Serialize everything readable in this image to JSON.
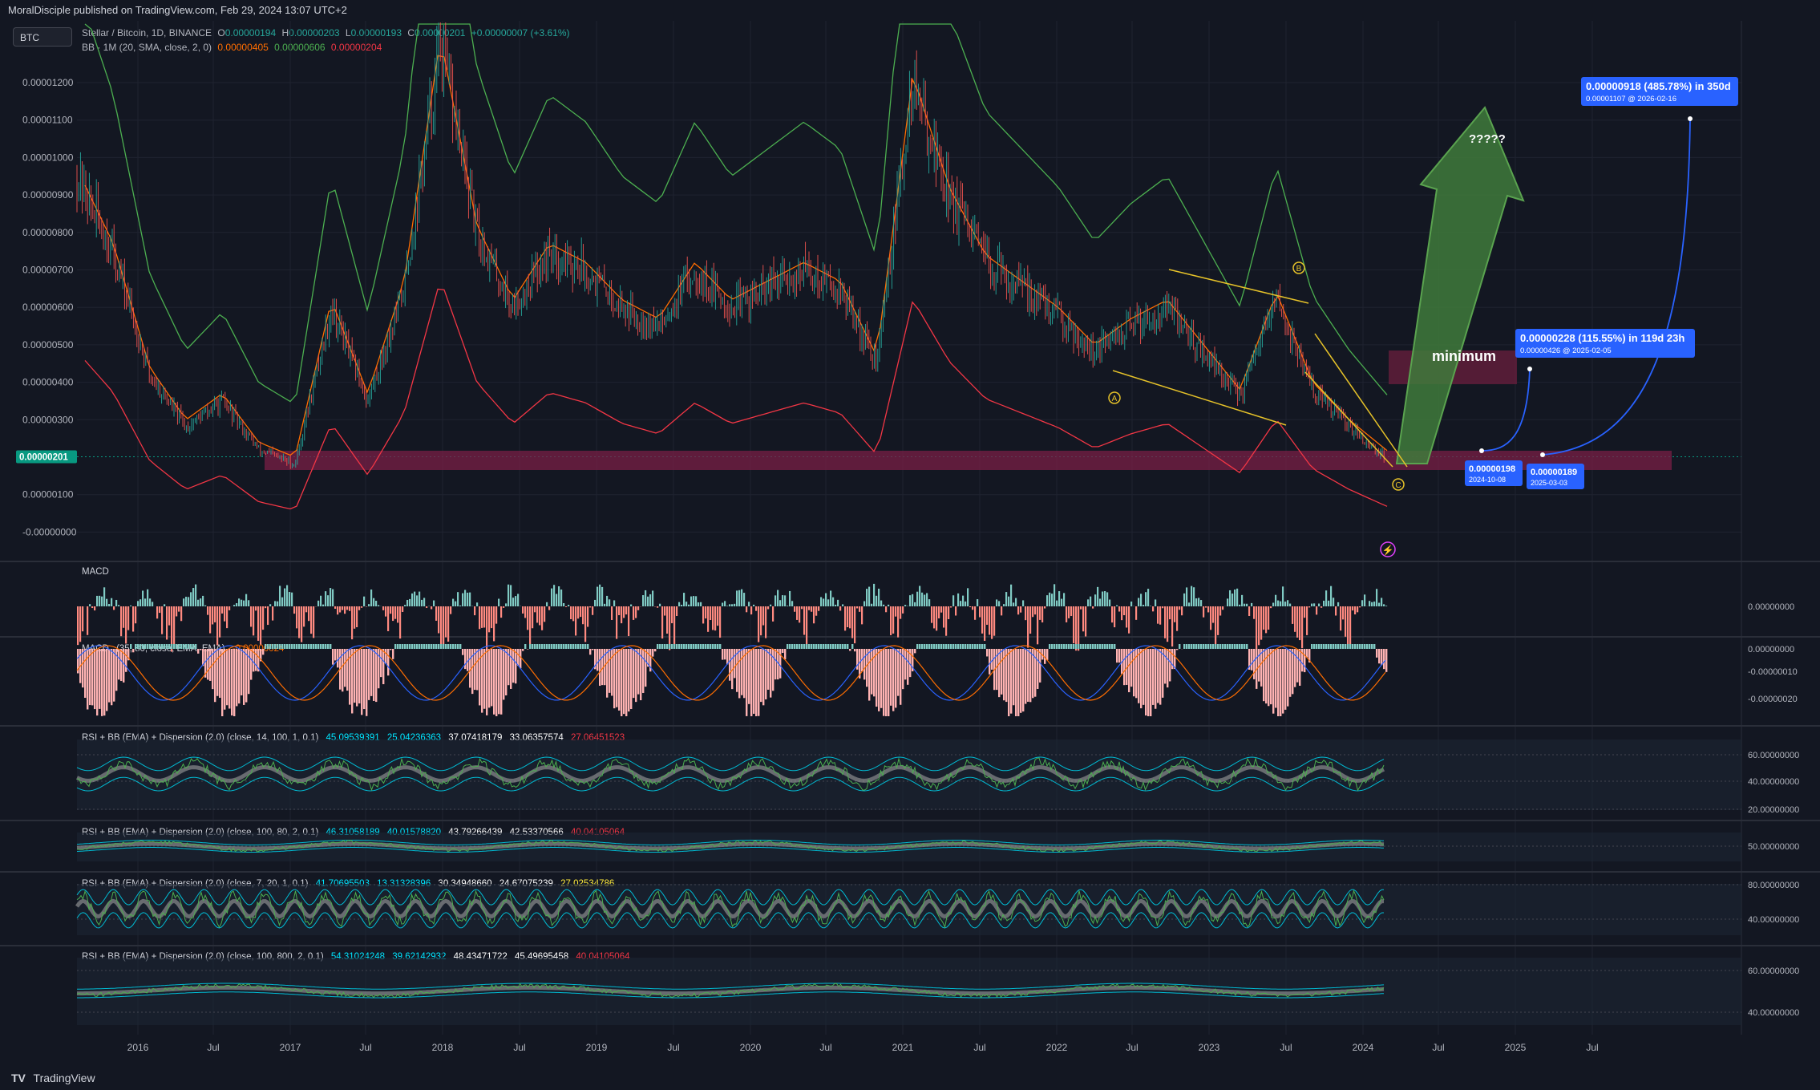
{
  "header": {
    "published": "MoralDisciple published on TradingView.com, Feb 29, 2024 13:07 UTC+2"
  },
  "footer": {
    "brand": "TradingView"
  },
  "symbol_badge": "BTC",
  "legend_main": {
    "title": "Stellar / Bitcoin, 1D, BINANCE",
    "o_label": "O",
    "o": "0.00000194",
    "h_label": "H",
    "h": "0.00000203",
    "l_label": "L",
    "l": "0.00000193",
    "c_label": "C",
    "c": "0.00000201",
    "change": "+0.00000007 (+3.61%)"
  },
  "legend_bb": {
    "label": "BB · 1M (20, SMA, close, 2, 0)",
    "v1": "0.00000405",
    "v2": "0.00000606",
    "v3": "0.00000204"
  },
  "price_axis": {
    "labels": [
      "0.00001200",
      "0.00001100",
      "0.00001000",
      "0.00000900",
      "0.00000800",
      "0.00000700",
      "0.00000600",
      "0.00000500",
      "0.00000400",
      "0.00000300",
      "0.00000100",
      "-0.00000000"
    ],
    "current": "0.00000201"
  },
  "annotations": {
    "wave_a": "A",
    "wave_b": "B",
    "wave_c": "C",
    "minimum": "minimum",
    "question": "?????",
    "proj1_title": "0.00000228 (115.55%) in 119d 23h",
    "proj1_sub": "0.00000426 @ 2025-02-05",
    "proj2_title": "0.00000918 (485.78%) in 350d",
    "proj2_sub": "0.00001107 @ 2026-02-16",
    "point1_val": "0.00000198",
    "point1_date": "2024-10-08",
    "point2_val": "0.00000189",
    "point2_date": "2025-03-03"
  },
  "panels": {
    "macd1": {
      "label": "MACD",
      "axis": [
        "0.00000000"
      ]
    },
    "macd2": {
      "label": "MACD",
      "params": "(35, 80, close, EMA, EMA)",
      "v": "-0.00000024",
      "axis": [
        "0.00000000",
        "-0.00000010",
        "-0.00000020"
      ]
    },
    "rsi1": {
      "label": "RSI + BB (EMA) + Dispersion (2.0) (close, 14, 100, 1, 0.1)",
      "values": [
        "45.09539391",
        "25.04236363",
        "37.07418179",
        "33.06357574",
        "27.06451523"
      ],
      "axis": [
        "60.00000000",
        "40.00000000",
        "20.00000000"
      ]
    },
    "rsi2": {
      "label": "RSI + BB (EMA) + Dispersion (2.0) (close, 100, 80, 2, 0.1)",
      "values": [
        "46.31058189",
        "40.01578820",
        "43.79266439",
        "42.53370566",
        "40.04105064"
      ],
      "axis": [
        "50.00000000"
      ]
    },
    "rsi3": {
      "label": "RSI + BB (EMA) + Dispersion (2.0) (close, 7, 20, 1, 0.1)",
      "values": [
        "41.70695503",
        "13.31328396",
        "30.34948660",
        "24.67075239",
        "27.02534786"
      ],
      "axis": [
        "80.00000000",
        "40.00000000"
      ]
    },
    "rsi4": {
      "label": "RSI + BB (EMA) + Dispersion (2.0) (close, 100, 800, 2, 0.1)",
      "values": [
        "54.31024248",
        "39.62142932",
        "48.43471722",
        "45.49695458",
        "40.04105064"
      ],
      "axis": [
        "60.00000000",
        "40.00000000"
      ]
    }
  },
  "time_axis": [
    "2016",
    "Jul",
    "2017",
    "Jul",
    "2018",
    "Jul",
    "2019",
    "Jul",
    "2020",
    "Jul",
    "2021",
    "Jul",
    "2022",
    "Jul",
    "2023",
    "Jul",
    "2024",
    "Jul",
    "2025",
    "Jul"
  ],
  "colors": {
    "bg": "#131722",
    "grid": "#1f2330",
    "up": "#26a69a",
    "down": "#ef5350",
    "bb_upper": "#4caf50",
    "bb_basis": "#ff6d00",
    "bb_lower": "#f23645",
    "zone": "#7a1f45",
    "label_blue": "#2962ff",
    "wave": "#e6c229",
    "arrow": "#3f7a3b"
  },
  "chart_data": {
    "type": "line",
    "title": "Stellar / Bitcoin, 1D, BINANCE",
    "xlabel": "",
    "ylabel": "",
    "ylim": [
      -1e-07,
      1.3e-06
    ],
    "x": [
      "2015-09",
      "2016-01",
      "2016-04",
      "2016-07",
      "2016-10",
      "2017-01",
      "2017-03",
      "2017-06",
      "2017-09",
      "2017-12",
      "2018-01",
      "2018-04",
      "2018-07",
      "2018-10",
      "2019-01",
      "2019-04",
      "2019-07",
      "2019-10",
      "2020-01",
      "2020-04",
      "2020-07",
      "2020-10",
      "2021-01",
      "2021-02",
      "2021-05",
      "2021-08",
      "2021-11",
      "2022-02",
      "2022-05",
      "2022-08",
      "2022-11",
      "2023-02",
      "2023-05",
      "2023-07",
      "2023-10",
      "2024-01",
      "2024-02"
    ],
    "series": [
      {
        "name": "",
        "values": [
          9.5e-06,
          7.5e-06,
          4.2e-06,
          2.8e-06,
          3.5e-06,
          2.2e-06,
          1.8e-06,
          6e-06,
          3.5e-06,
          6.5e-06,
          1.3e-05,
          8e-06,
          6e-06,
          7.5e-06,
          7e-06,
          6e-06,
          5.5e-06,
          7e-06,
          6e-06,
          6.5e-06,
          7e-06,
          6.5e-06,
          4.5e-06,
          1.2e-05,
          9e-06,
          7.2e-06,
          6.5e-06,
          5.8e-06,
          4.8e-06,
          5.5e-06,
          6e-06,
          4.8e-06,
          3.6e-06,
          6.2e-06,
          3.8e-06,
          2.8e-06,
          2.01e-06
        ]
      }
    ],
    "grid": true
  }
}
